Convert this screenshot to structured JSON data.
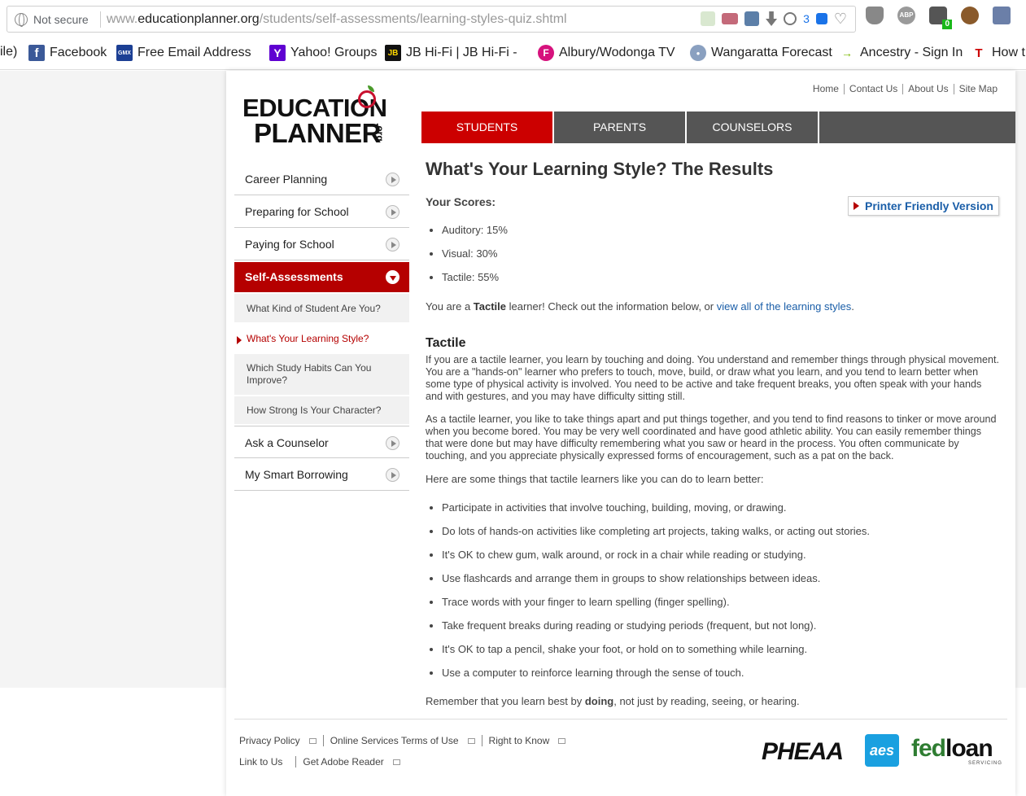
{
  "browser": {
    "not_secure": "Not secure",
    "url_prefix": "www.",
    "url_domain": "educationplanner.org",
    "url_path": "/students/self-assessments/learning-styles-quiz.shtml",
    "tab_count": "3",
    "ext_badge": "0",
    "abp_label": "ABP"
  },
  "bookmarks": [
    {
      "label": "ile)",
      "icon": "none"
    },
    {
      "label": "Facebook",
      "icon": "facebook-icon",
      "color": "#3b5998",
      "glyph": "f"
    },
    {
      "label": "Free Email Addresses",
      "icon": "gmx-icon",
      "color": "#1c3f94",
      "glyph": "GMX"
    },
    {
      "label": "Yahoo! Groups",
      "icon": "yahoo-icon",
      "color": "#5f01d1",
      "glyph": "Y"
    },
    {
      "label": "JB Hi-Fi | JB Hi-Fi - Au",
      "icon": "jbhifi-icon",
      "color": "#111111",
      "glyph": "JB"
    },
    {
      "label": "Albury/Wodonga TV",
      "icon": "f-icon",
      "color": "#d6127d",
      "glyph": "F"
    },
    {
      "label": "Wangaratta Forecast",
      "icon": "weather-icon",
      "color": "#8aa0c0",
      "glyph": "●"
    },
    {
      "label": "Ancestry - Sign In",
      "icon": "ancestry-icon",
      "color": "#7ab800",
      "glyph": "→"
    },
    {
      "label": "How t",
      "icon": "t-icon",
      "color": "#cc0000",
      "glyph": "T"
    }
  ],
  "site": {
    "logo_line1": "EDUCATION",
    "logo_line2": "PLANNER",
    "logo_org": ".org",
    "util_links": [
      "Home",
      "Contact Us",
      "About Us",
      "Site Map"
    ],
    "tabs": [
      {
        "label": "STUDENTS",
        "active": true
      },
      {
        "label": "PARENTS",
        "active": false
      },
      {
        "label": "COUNSELORS",
        "active": false
      }
    ],
    "sidebar": {
      "top": [
        "Career Planning",
        "Preparing for School",
        "Paying for School"
      ],
      "active": "Self-Assessments",
      "sub": [
        "What Kind of Student Are You?",
        "What's Your Learning Style?",
        "Which Study Habits Can You Improve?",
        "How Strong Is Your Character?"
      ],
      "bottom": [
        "Ask a Counselor",
        "My Smart Borrowing"
      ]
    },
    "main": {
      "title": "What's Your Learning Style? The Results",
      "scores_label": "Your Scores:",
      "printer": "Printer Friendly Version",
      "scores": [
        "Auditory: 15%",
        "Visual: 30%",
        "Tactile: 55%"
      ],
      "intro_pre": "You are a ",
      "intro_bold": "Tactile",
      "intro_mid": " learner! Check out the information below, or ",
      "intro_link": "view all of the learning styles",
      "intro_end": ".",
      "style_title": "Tactile",
      "para1": "If you are a tactile learner, you learn by touching and doing. You understand and remember things through physical movement. You are a \"hands-on\" learner who prefers to touch, move, build, or draw what you learn, and you tend to learn better when some type of physical activity is involved. You need to be active and take frequent breaks, you often speak with your hands and with gestures, and you may have difficulty sitting still.",
      "para2": "As a tactile learner, you like to take things apart and put things together, and you tend to find reasons to tinker or move around when you become bored. You may be very well coordinated and have good athletic ability. You can easily remember things that were done but may have difficulty remembering what you saw or heard in the process. You often communicate by touching, and you appreciate physically expressed forms of encouragement, such as a pat on the back.",
      "tips_intro": "Here are some things that tactile learners like you can do to learn better:",
      "tips": [
        "Participate in activities that involve touching, building, moving, or drawing.",
        "Do lots of hands-on activities like completing art projects, taking walks, or acting out stories.",
        "It's OK to chew gum, walk around, or rock in a chair while reading or studying.",
        "Use flashcards and arrange them in groups to show relationships between ideas.",
        "Trace words with your finger to learn spelling (finger spelling).",
        "Take frequent breaks during reading or studying periods (frequent, but not long).",
        "It's OK to tap a pencil, shake your foot, or hold on to something while learning.",
        "Use a computer to reinforce learning through the sense of touch."
      ],
      "remember_pre": "Remember that you learn best by ",
      "remember_bold": "doing",
      "remember_post": ", not just by reading, seeing, or hearing."
    },
    "footer": {
      "row1": [
        "Privacy Policy",
        "Online Services Terms of Use",
        "Right to Know"
      ],
      "row2": [
        "Link to Us",
        "Get Adobe Reader"
      ],
      "pheaa": "PHEAA",
      "aes": "aes",
      "fedloan_fed": "fed",
      "fedloan_loan": "loan",
      "servicing": "SERVICING"
    }
  }
}
